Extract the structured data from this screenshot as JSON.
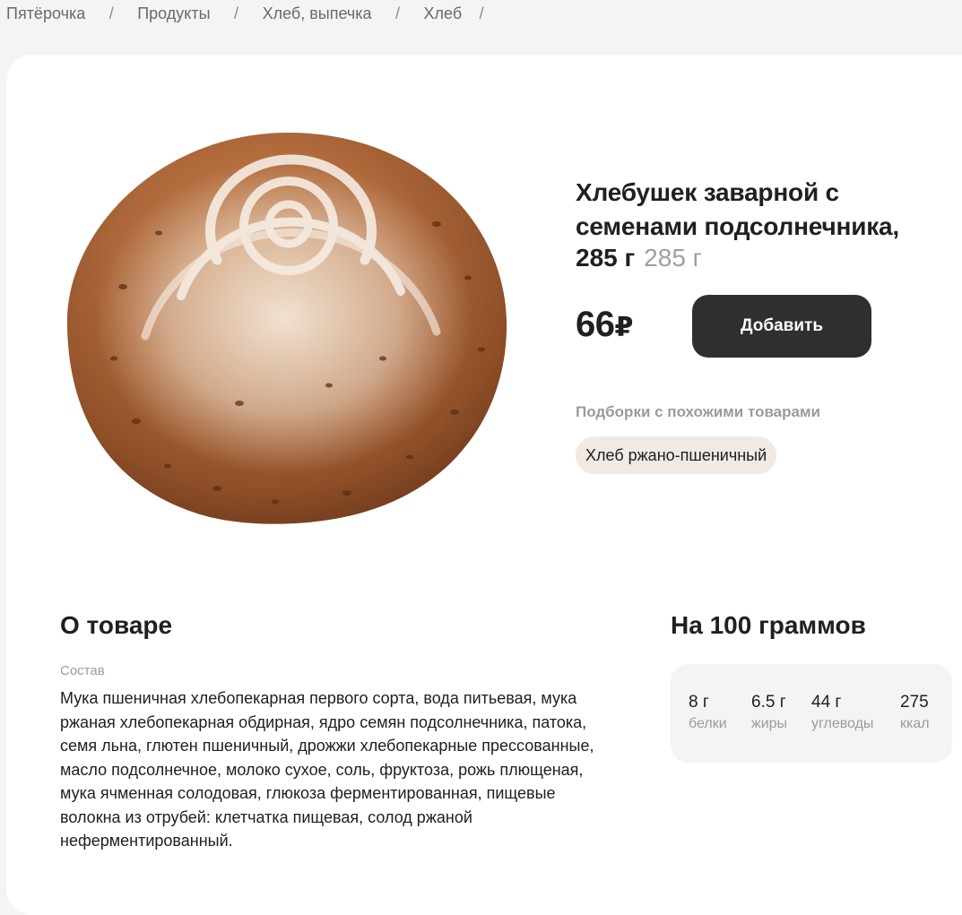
{
  "breadcrumbs": [
    {
      "label": "Пятёрочка"
    },
    {
      "label": "Продукты"
    },
    {
      "label": "Хлеб, выпечка"
    },
    {
      "label": "Хлеб"
    }
  ],
  "breadcrumb_separator": "/",
  "product": {
    "title": "Хлебушек заварной с семенами подсолнечника,",
    "weight": "285 г",
    "weight_secondary": "285 г",
    "price": "66",
    "currency": "₽",
    "add_button_label": "Добавить"
  },
  "similar": {
    "title": "Подборки с похожими товарами",
    "chips": [
      {
        "label": "Хлеб ржано-пшеничный"
      }
    ]
  },
  "about": {
    "title": "О товаре",
    "composition_label": "Состав",
    "composition_text": "Мука пшеничная хлебопекарная первого сорта, вода питьевая, мука ржаная хлебопекарная обдирная, ядро семян подсолнечника, патока, семя льна, глютен пшеничный, дрожжи хлебопекарные прессованные, масло подсолнечное, молоко сухое, соль, фруктоза, рожь плющеная, мука ячменная солодовая, глюкоза ферментированная, пищевые волокна из отрубей: клетчатка пищевая, солод ржаной неферментированный."
  },
  "nutrition": {
    "title": "На 100 граммов",
    "items": [
      {
        "value": "8 г",
        "label": "белки"
      },
      {
        "value": "6.5 г",
        "label": "жиры"
      },
      {
        "value": "44 г",
        "label": "углеводы"
      },
      {
        "value": "275",
        "label": "ккал"
      }
    ]
  },
  "colors": {
    "page_background": "#f5f4f2",
    "card_background": "#ffffff",
    "button_background": "#302f2d",
    "chip_background": "#f0e9e4",
    "muted_text": "#9c9b99"
  }
}
